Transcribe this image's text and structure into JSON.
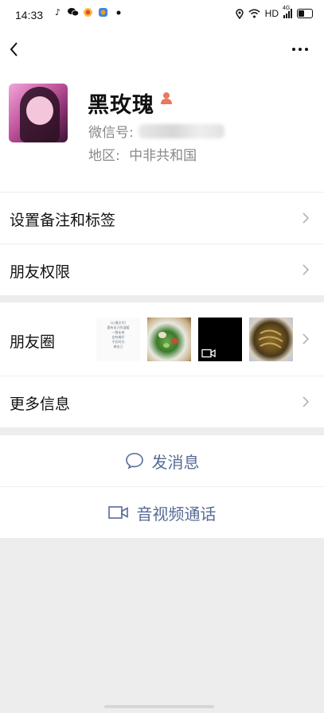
{
  "status_bar": {
    "time": "14:33",
    "network": "HD",
    "signal_label": "4G",
    "left_icons": [
      "tiktok-icon",
      "wechat-icon",
      "app-icon",
      "app-icon",
      "dot-icon"
    ],
    "right_icons": [
      "location-icon",
      "wifi-icon",
      "signal-icon",
      "battery-icon"
    ]
  },
  "nav": {
    "back_icon": "chevron-left-icon",
    "more_icon": "more-dots-icon"
  },
  "profile": {
    "nickname": "黑玫瑰",
    "gender_icon": "female-person-icon",
    "wechat_id_label": "微信号:",
    "region_label": "地区:",
    "region_value": "中非共和国"
  },
  "rows": {
    "remark_tags": "设置备注和标签",
    "friend_permissions": "朋友权限",
    "moments": "朋友圈",
    "more_info": "更多信息"
  },
  "moments_preview": {
    "text_post_lines": [
      "(心情文字)",
      "要有自己的温暖",
      "一路走来",
      "会有美好",
      "不负时光",
      "做自己"
    ]
  },
  "actions": {
    "send_message": "发消息",
    "send_message_icon": "chat-bubble-icon",
    "video_call": "音视频通话",
    "video_call_icon": "video-camera-icon"
  },
  "colors": {
    "link_blue": "#576b95",
    "background": "#ededed",
    "gender_icon": "#e8795e"
  }
}
